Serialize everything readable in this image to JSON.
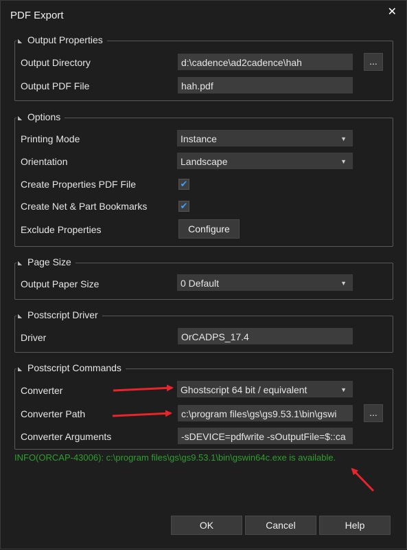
{
  "dialog": {
    "title": "PDF Export",
    "close_glyph": "✕"
  },
  "output_properties": {
    "legend": "Output Properties",
    "output_directory_label": "Output Directory",
    "output_directory_value": "d:\\cadence\\ad2cadence\\hah",
    "browse_label": "...",
    "output_pdf_label": "Output PDF File",
    "output_pdf_value": "hah.pdf"
  },
  "options": {
    "legend": "Options",
    "printing_mode_label": "Printing Mode",
    "printing_mode_value": "Instance",
    "orientation_label": "Orientation",
    "orientation_value": "Landscape",
    "create_properties_label": "Create Properties PDF File",
    "create_properties_checked": true,
    "create_bookmarks_label": "Create Net & Part Bookmarks",
    "create_bookmarks_checked": true,
    "exclude_properties_label": "Exclude Properties",
    "configure_label": "Configure"
  },
  "page_size": {
    "legend": "Page Size",
    "output_paper_size_label": "Output Paper Size",
    "output_paper_size_value": "0 Default"
  },
  "postscript_driver": {
    "legend": "Postscript Driver",
    "driver_label": "Driver",
    "driver_value": "OrCADPS_17.4"
  },
  "postscript_commands": {
    "legend": "Postscript Commands",
    "converter_label": "Converter",
    "converter_value": "Ghostscript 64 bit / equivalent",
    "converter_path_label": "Converter Path",
    "converter_path_value": "c:\\program files\\gs\\gs9.53.1\\bin\\gswi",
    "browse_label": "...",
    "converter_args_label": "Converter Arguments",
    "converter_args_value": "-sDEVICE=pdfwrite -sOutputFile=$::ca"
  },
  "info_message": "INFO(ORCAP-43006): c:\\program files\\gs\\gs9.53.1\\bin\\gswin64c.exe is available.",
  "buttons": {
    "ok": "OK",
    "cancel": "Cancel",
    "help": "Help"
  },
  "colors": {
    "accent_check": "#3aa0ff",
    "info_green": "#2f9f2f",
    "annotation_red": "#e8252a"
  },
  "icons": {
    "legend_collapse": "collapse-triangle-icon",
    "dropdown": "chevron-down-icon",
    "close": "close-icon"
  }
}
